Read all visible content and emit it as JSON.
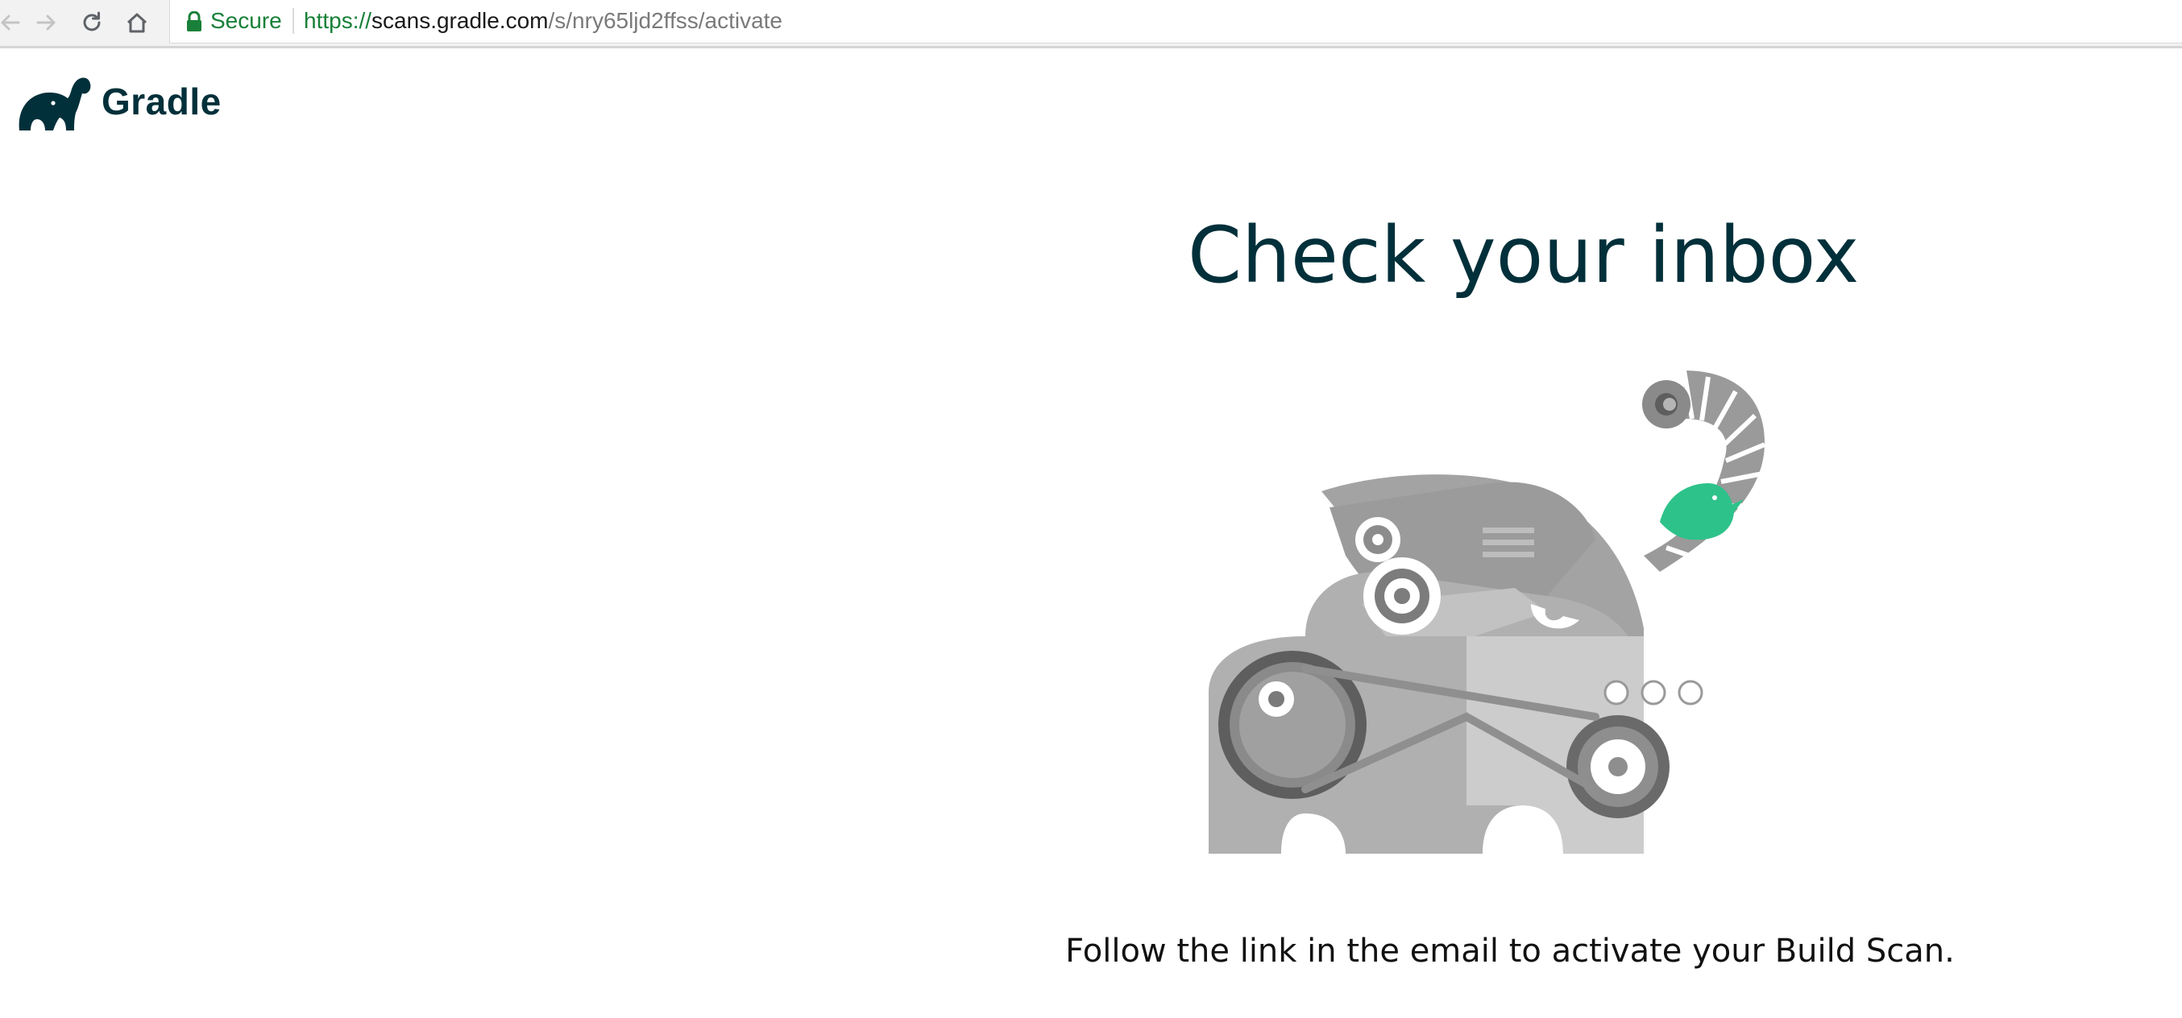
{
  "browser": {
    "security_label": "Secure",
    "url": {
      "scheme": "https://",
      "host": "scans.gradle.com",
      "path": "/s/nry65ljd2ffss/activate"
    },
    "icons": [
      "back-icon",
      "forward-icon",
      "reload-icon",
      "home-icon",
      "lock-icon"
    ]
  },
  "header": {
    "brand": "Gradle",
    "logo_icon": "elephant-logo-icon"
  },
  "main": {
    "title": "Check your inbox",
    "illustration_icon": "mechanical-elephant-illustration",
    "message": "Follow the link in the email to activate your Build Scan."
  },
  "colors": {
    "brand_dark": "#02303a",
    "accent_green": "#2ec28b",
    "secure_green": "#188038"
  }
}
